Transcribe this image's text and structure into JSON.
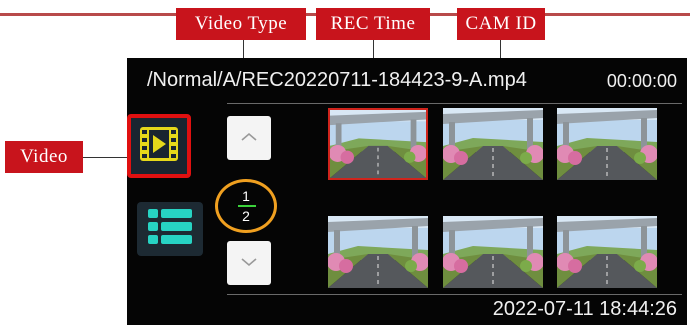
{
  "callouts": {
    "video_type": "Video Type",
    "rec_time": "REC Time",
    "cam_id": "CAM ID",
    "video": "Video"
  },
  "screen": {
    "file_path": "/Normal/A/REC20220711-184423-9-A.mp4",
    "playback_time": "00:00:00",
    "page": {
      "current": "1",
      "total": "2"
    },
    "datetime": "2022-07-11 18:44:26",
    "thumbnails": [
      {
        "selected": true
      },
      {
        "selected": false
      },
      {
        "selected": false
      },
      {
        "selected": false
      },
      {
        "selected": false
      },
      {
        "selected": false
      }
    ],
    "icons": {
      "video_mode": "video-film-icon",
      "list_mode": "list-icon",
      "page_up": "chevron-up-icon",
      "page_down": "chevron-down-icon"
    },
    "colors": {
      "callout_red": "#c8141c",
      "page_ring": "#f0a020",
      "video_icon": "#e6d81a",
      "list_icon": "#27d3c3"
    }
  }
}
